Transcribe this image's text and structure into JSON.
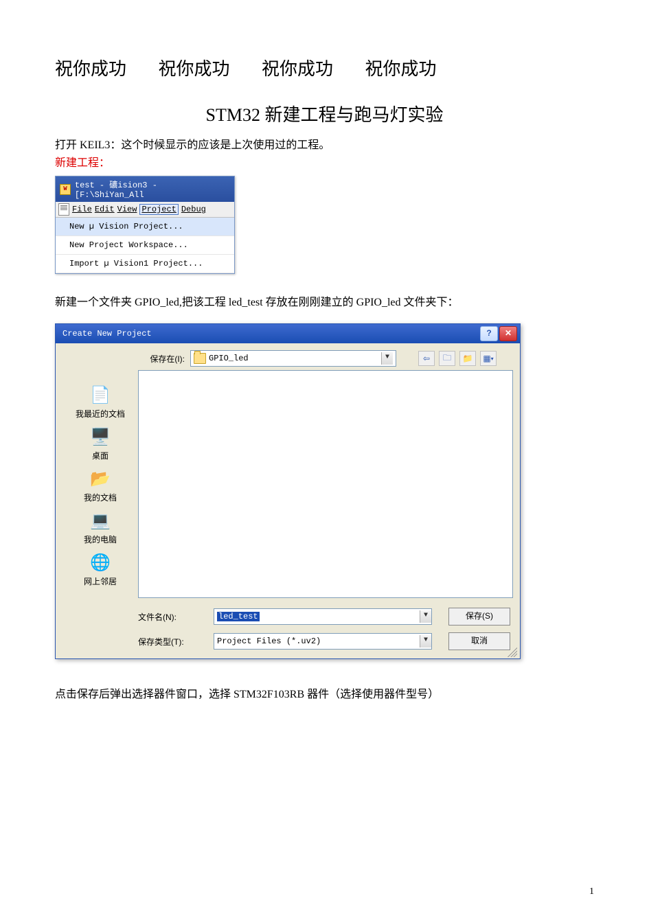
{
  "header": {
    "wish": "祝你成功",
    "title": "STM32 新建工程与跑马灯实验"
  },
  "intro": {
    "line1": "打开 KEIL3：这个时候显示的应该是上次使用过的工程。",
    "new_project_label": "新建工程："
  },
  "keil": {
    "titlebar": "test  - 礦ision3 - [F:\\ShiYan_All",
    "menu": {
      "file": "File",
      "edit": "Edit",
      "view": "View",
      "project": "Project",
      "debug": "Debug"
    },
    "sub": {
      "new_vision": "New µ Vision Project...",
      "new_ws": "New Project Workspace...",
      "import": "Import µ Vision1 Project..."
    }
  },
  "para2": "新建一个文件夹 GPIO_led,把该工程 led_test 存放在刚刚建立的 GPIO_led 文件夹下：",
  "dialog": {
    "title": "Create New Project",
    "save_in_label": "保存在(I):",
    "folder": "GPIO_led",
    "places": {
      "recent": "我最近的文档",
      "desktop": "桌面",
      "mydocs": "我的文档",
      "mycomp": "我的电脑",
      "network": "网上邻居"
    },
    "filename_label": "文件名(N):",
    "filename_value": "led_test",
    "type_label": "保存类型(T):",
    "type_value": "Project Files (*.uv2)",
    "save_btn": "保存(S)",
    "cancel_btn": "取消",
    "help_btn": "?",
    "close_btn": "✕",
    "nav": {
      "back": "⇦",
      "up": "🗀",
      "new": "📁",
      "views": "▦"
    }
  },
  "para3": "点击保存后弹出选择器件窗口，选择 STM32F103RB 器件（选择使用器件型号）",
  "page_number": "1"
}
